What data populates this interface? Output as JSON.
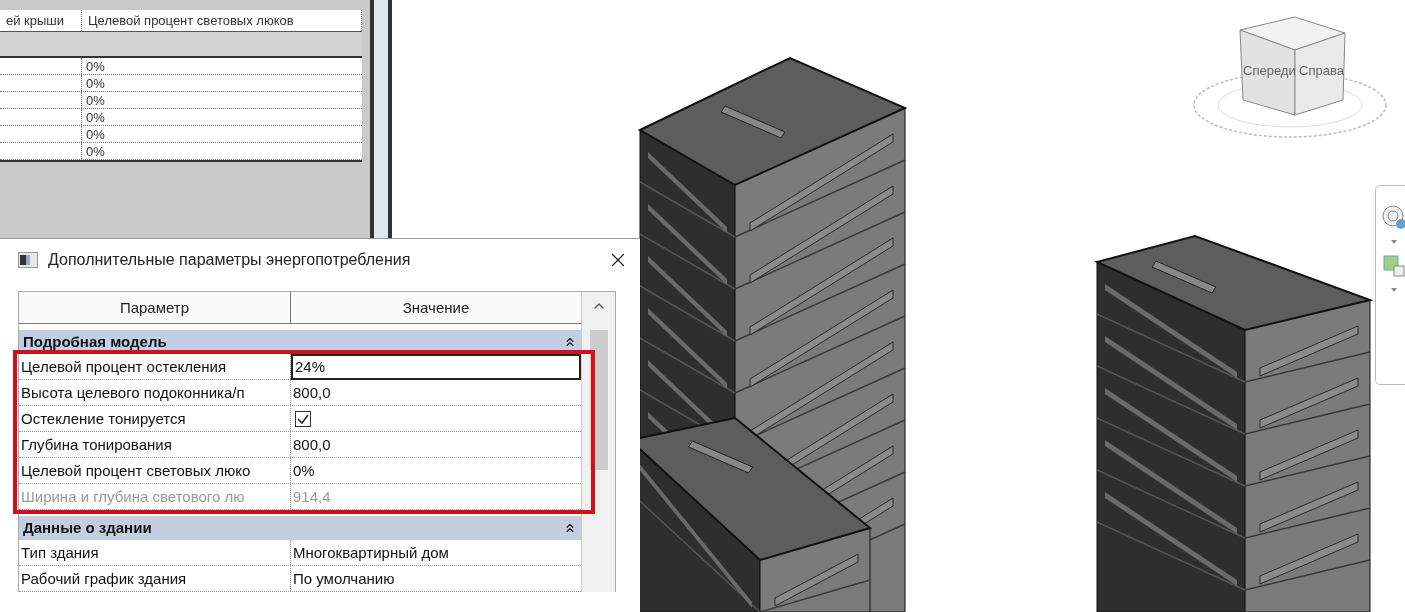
{
  "schedule": {
    "columns": [
      "ей крыши",
      "Целевой процент световых люков"
    ],
    "rows": [
      {
        "column_2": "0%"
      },
      {
        "column_2": "0%"
      },
      {
        "column_2": "0%"
      },
      {
        "column_2": "0%"
      },
      {
        "column_2": "0%"
      },
      {
        "column_2": "0%"
      }
    ]
  },
  "dialog": {
    "title": "Дополнительные параметры энергопотребления",
    "columns": [
      "Параметр",
      "Значение"
    ],
    "groups": [
      {
        "title": "Подробная модель",
        "expanded": true,
        "rows": [
          {
            "kind": "text",
            "label": "Целевой процент остекления",
            "value": "24%",
            "editing": true,
            "disabled": false
          },
          {
            "kind": "text",
            "label": "Высота целевого подоконника/п",
            "value": "800,0",
            "editing": false,
            "disabled": false
          },
          {
            "kind": "checkbox",
            "label": "Остекление тонируется",
            "checked": true,
            "editing": false,
            "disabled": false
          },
          {
            "kind": "text",
            "label": "Глубина тонирования",
            "value": "800,0",
            "editing": false,
            "disabled": false
          },
          {
            "kind": "text",
            "label": "Целевой процент световых люко",
            "value": "0%",
            "editing": false,
            "disabled": false
          },
          {
            "kind": "text",
            "label": "Ширина и глубина светового лю",
            "value": "914,4",
            "editing": false,
            "disabled": true
          }
        ]
      },
      {
        "title": "Данные о здании",
        "expanded": true,
        "rows": [
          {
            "kind": "text",
            "label": "Тип здания",
            "value": "Многоквартирный дом",
            "editing": false,
            "disabled": false
          },
          {
            "kind": "text",
            "label": "Рабочий график здания",
            "value": "По умолчанию",
            "editing": false,
            "disabled": false
          }
        ]
      }
    ]
  },
  "view_cube": {
    "labels": [
      "Спереди",
      "Справа"
    ]
  }
}
